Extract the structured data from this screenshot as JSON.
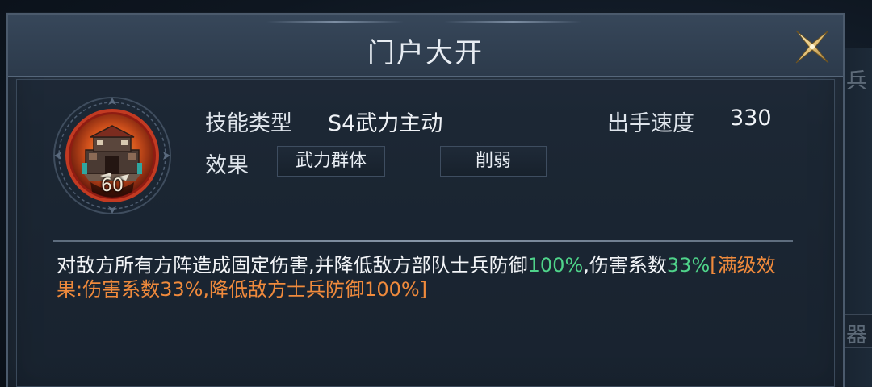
{
  "dialog": {
    "title": "门户大开"
  },
  "skill": {
    "level": "60",
    "type_label": "技能类型",
    "type_value": "S4武力主动",
    "speed_label": "出手速度",
    "speed_value": "330",
    "effect_label": "效果",
    "effect_tags": [
      "武力群体",
      "削弱"
    ]
  },
  "description": {
    "part1": "对敌方所有方阵造成固定伤害,并降低敌方部队士兵防御",
    "value1": "100%",
    "part2": ",伤害系数",
    "value2": "33%",
    "full_level_effect": "[满级效果:伤害系数33%,降低敌方士兵防御100%]"
  },
  "background": {
    "side_label_top": "兵",
    "side_label_bottom": "器"
  },
  "colors": {
    "highlight_green": "#4fd38a",
    "full_level_orange": "#f08a3c",
    "close_icon_gold": "#e3c27a"
  },
  "icons": {
    "close": "close-x-icon",
    "skill": "fortress-gate-icon"
  }
}
